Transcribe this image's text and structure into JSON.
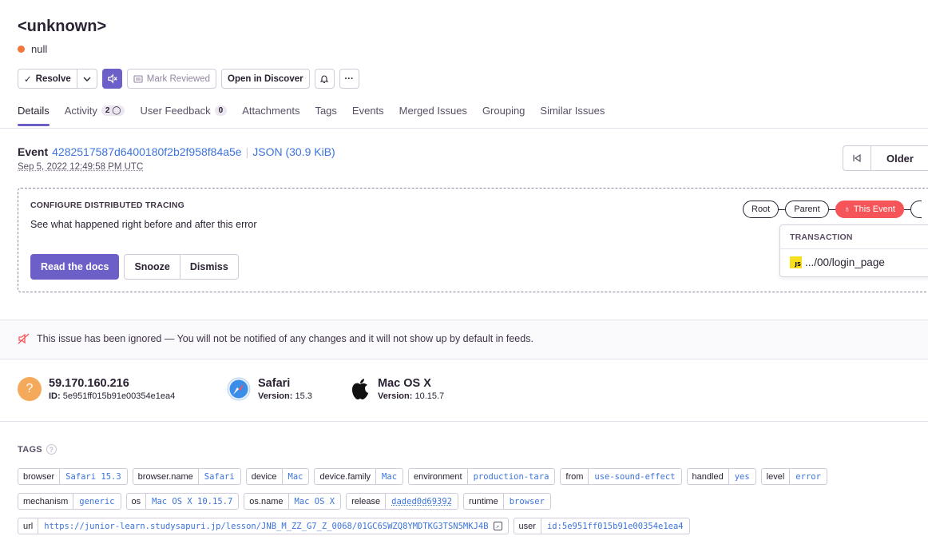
{
  "header": {
    "title": "<unknown>",
    "subtitle": "null"
  },
  "actions": {
    "resolve": "Resolve",
    "mark_reviewed": "Mark Reviewed",
    "open_discover": "Open in Discover"
  },
  "tabs": [
    {
      "label": "Details"
    },
    {
      "label": "Activity",
      "count": "2"
    },
    {
      "label": "User Feedback",
      "count": "0"
    },
    {
      "label": "Attachments"
    },
    {
      "label": "Tags"
    },
    {
      "label": "Events"
    },
    {
      "label": "Merged Issues"
    },
    {
      "label": "Grouping"
    },
    {
      "label": "Similar Issues"
    }
  ],
  "event": {
    "label": "Event",
    "id": "4282517587d6400180f2b2f958f84a5e",
    "json": "JSON (30.9 KiB)",
    "date": "Sep 5, 2022 12:49:58 PM UTC",
    "older": "Older"
  },
  "tracing": {
    "heading": "CONFIGURE DISTRIBUTED TRACING",
    "description": "See what happened right before and after this error",
    "read_docs": "Read the docs",
    "snooze": "Snooze",
    "dismiss": "Dismiss",
    "crumbs": {
      "root": "Root",
      "parent": "Parent",
      "this_event": "This Event"
    },
    "transaction_heading": "TRANSACTION",
    "transaction": ".../00/login_page",
    "js_badge": "JS"
  },
  "ignored": {
    "text": "This issue has been ignored — You will not be notified of any changes and it will not show up by default in feeds."
  },
  "context": {
    "user": {
      "value": "59.170.160.216",
      "id_label": "ID:",
      "id": "5e951ff015b91e00354e1ea4",
      "avatar": "?"
    },
    "browser": {
      "name": "Safari",
      "version_label": "Version:",
      "version": "15.3"
    },
    "os": {
      "name": "Mac OS X",
      "version_label": "Version:",
      "version": "10.15.7"
    }
  },
  "tags_heading": "TAGS",
  "tags": {
    "row1": [
      {
        "k": "browser",
        "v": "Safari 15.3"
      },
      {
        "k": "browser.name",
        "v": "Safari"
      },
      {
        "k": "device",
        "v": "Mac"
      },
      {
        "k": "device.family",
        "v": "Mac"
      },
      {
        "k": "environment",
        "v": "production-tara"
      },
      {
        "k": "from",
        "v": "use-sound-effect"
      },
      {
        "k": "handled",
        "v": "yes"
      },
      {
        "k": "level",
        "v": "error"
      }
    ],
    "row2": [
      {
        "k": "mechanism",
        "v": "generic"
      },
      {
        "k": "os",
        "v": "Mac OS X 10.15.7"
      },
      {
        "k": "os.name",
        "v": "Mac OS X"
      },
      {
        "k": "release",
        "v": "daded0d69392"
      },
      {
        "k": "runtime",
        "v": "browser"
      }
    ],
    "row3": [
      {
        "k": "url",
        "v": "https://junior-learn.studysapuri.jp/lesson/JNB_M_ZZ_G7_Z_0068/01GC6SWZQ8YMDTKG3TSN5MKJ4B"
      },
      {
        "k": "user",
        "v": "id:5e951ff015b91e00354e1ea4"
      }
    ]
  },
  "colors": {
    "accent": "#6c5fc7",
    "link": "#3d74db",
    "error": "#f55459",
    "warning": "#f2773c"
  }
}
